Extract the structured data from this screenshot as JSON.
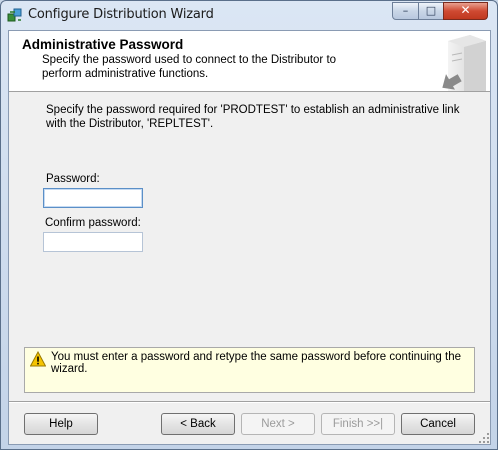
{
  "window": {
    "title": "Configure Distribution Wizard",
    "controls": {
      "minimize": "–",
      "maximize": "□",
      "close": "✕"
    }
  },
  "header": {
    "title": "Administrative Password",
    "subtitle": "Specify the password used to connect to the Distributor to perform administrative functions."
  },
  "body": {
    "intro": "Specify the password required for 'PRODTEST' to establish an administrative link with the Distributor, 'REPLTEST'.",
    "password_label": "Password:",
    "password_value": "",
    "confirm_label": "Confirm password:",
    "confirm_value": ""
  },
  "warning": {
    "icon": "warning-icon",
    "text": "You must enter a password and retype the same password before continuing the wizard."
  },
  "buttons": {
    "help": "Help",
    "back": "< Back",
    "next": "Next >",
    "finish": "Finish >>|",
    "cancel": "Cancel"
  },
  "colors": {
    "warning_bg": "#ffffe1",
    "client_bg": "#f0f0f0",
    "close_red": "#cf4a32"
  }
}
